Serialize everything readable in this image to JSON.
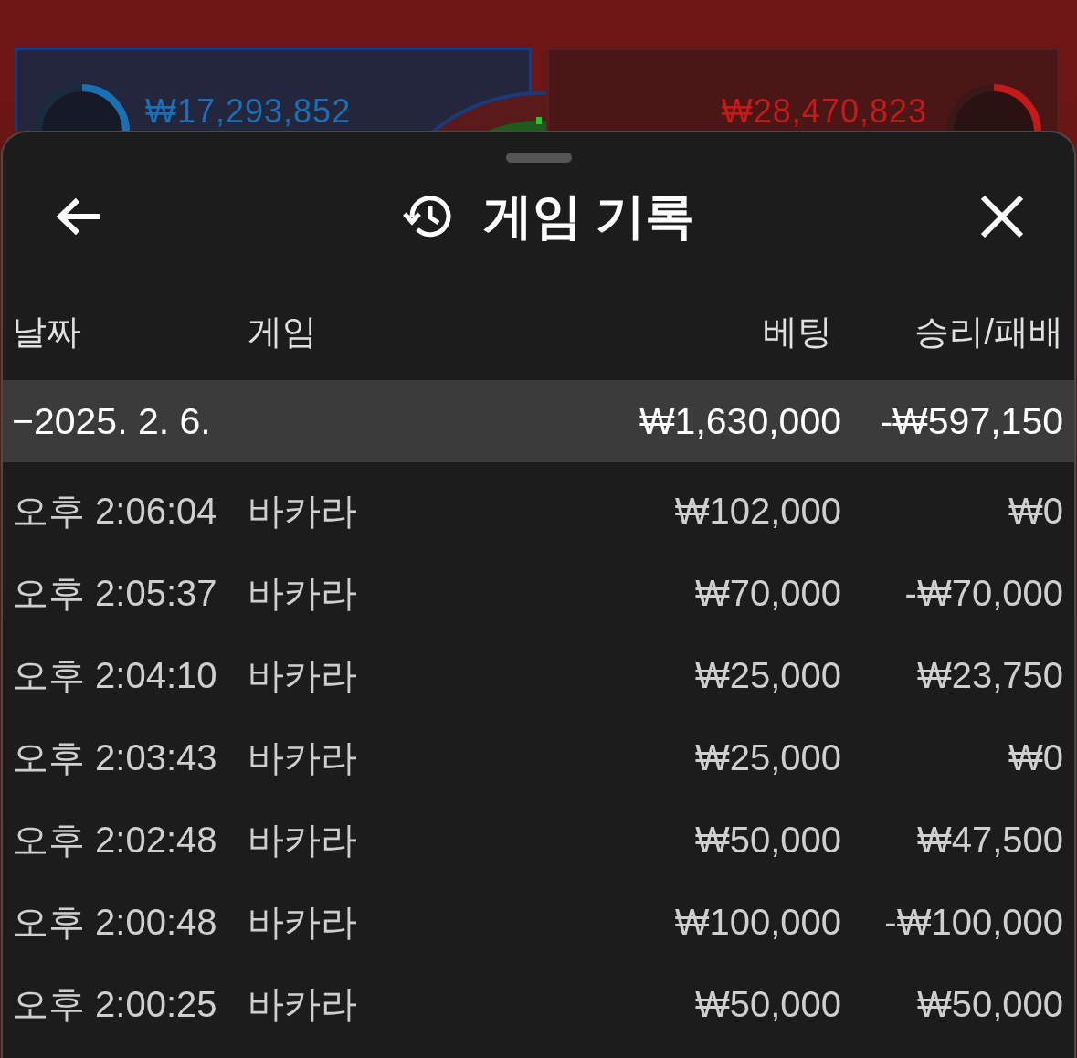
{
  "background": {
    "player": {
      "amount": "₩17,293,852"
    },
    "banker": {
      "amount": "₩28,470,823"
    }
  },
  "sheet": {
    "title": "게임 기록",
    "columns": [
      "날짜",
      "게임",
      "베팅",
      "승리/패배"
    ],
    "groups": [
      {
        "date": "−2025. 2. 6.",
        "bet": "₩1,630,000",
        "result": "-₩597,150",
        "rows": [
          {
            "time": "오후 2:06:04",
            "game": "바카라",
            "bet": "₩102,000",
            "result": "₩0"
          },
          {
            "time": "오후 2:05:37",
            "game": "바카라",
            "bet": "₩70,000",
            "result": "-₩70,000"
          },
          {
            "time": "오후 2:04:10",
            "game": "바카라",
            "bet": "₩25,000",
            "result": "₩23,750"
          },
          {
            "time": "오후 2:03:43",
            "game": "바카라",
            "bet": "₩25,000",
            "result": "₩0"
          },
          {
            "time": "오후 2:02:48",
            "game": "바카라",
            "bet": "₩50,000",
            "result": "₩47,500"
          },
          {
            "time": "오후 2:00:48",
            "game": "바카라",
            "bet": "₩100,000",
            "result": "-₩100,000"
          },
          {
            "time": "오후 2:00:25",
            "game": "바카라",
            "bet": "₩50,000",
            "result": "₩50,000"
          }
        ]
      }
    ]
  }
}
